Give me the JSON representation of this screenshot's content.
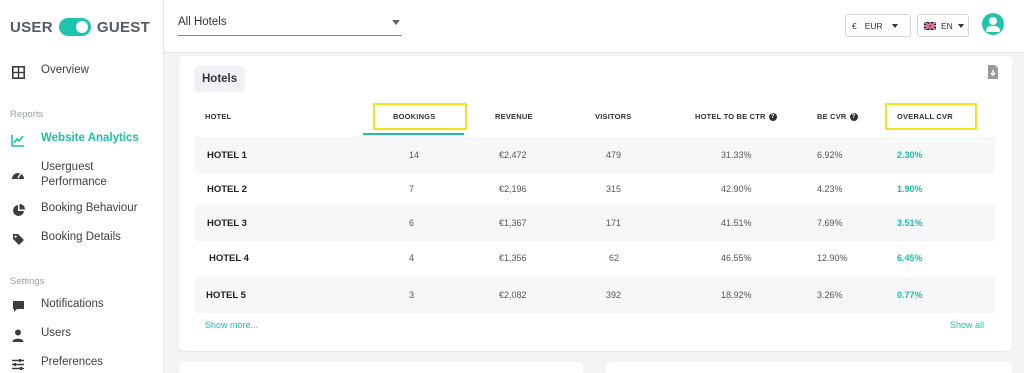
{
  "brand": {
    "left": "USER",
    "right": "GUEST"
  },
  "sidebar": {
    "items": [
      {
        "label": "Overview",
        "icon": "grid-icon"
      },
      {
        "label": "Website Analytics",
        "icon": "chart-line-icon",
        "active": true
      },
      {
        "label": "Userguest Performance",
        "line1": "Userguest",
        "line2": "Performance",
        "icon": "dashboard-gauge-icon"
      },
      {
        "label": "Booking Behaviour",
        "icon": "pie-chart-icon"
      },
      {
        "label": "Booking Details",
        "icon": "tag-icon"
      },
      {
        "label": "Notifications",
        "icon": "chat-bubble-icon"
      },
      {
        "label": "Users",
        "icon": "user-icon"
      },
      {
        "label": "Preferences",
        "icon": "sliders-icon"
      }
    ],
    "sections": {
      "reports": "Reports",
      "settings": "Settings"
    }
  },
  "topbar": {
    "hotel_select": "All Hotels",
    "currency": {
      "symbol": "€",
      "code": "EUR"
    },
    "language": "EN"
  },
  "card": {
    "tab": "Hotels",
    "columns": [
      "HOTEL",
      "BOOKINGS",
      "REVENUE",
      "VISITORS",
      "HOTEL TO BE CTR",
      "BE CVR",
      "OVERALL CVR"
    ],
    "rows": [
      {
        "hotel": "HOTEL 1",
        "bookings": "14",
        "revenue": "€2,472",
        "visitors": "479",
        "ctr": "31.33%",
        "be_cvr": "6.92%",
        "overall_cvr": "2.30%"
      },
      {
        "hotel": "HOTEL 2",
        "bookings": "7",
        "revenue": "€2,196",
        "visitors": "315",
        "ctr": "42.90%",
        "be_cvr": "4.23%",
        "overall_cvr": "1.90%"
      },
      {
        "hotel": "HOTEL 3",
        "bookings": "6",
        "revenue": "€1,367",
        "visitors": "171",
        "ctr": "41.51%",
        "be_cvr": "7.69%",
        "overall_cvr": "3.51%"
      },
      {
        "hotel": "HOTEL 4",
        "bookings": "4",
        "revenue": "€1,356",
        "visitors": "62",
        "ctr": "46.55%",
        "be_cvr": "12.90%",
        "overall_cvr": "6.45%"
      },
      {
        "hotel": "HOTEL 5",
        "bookings": "3",
        "revenue": "€2,082",
        "visitors": "392",
        "ctr": "18.92%",
        "be_cvr": "3.26%",
        "overall_cvr": "0.77%"
      }
    ],
    "show_more": "Show more...",
    "show_all": "Show all"
  },
  "colors": {
    "accent": "#1fbfa6",
    "highlight": "#f1e21b"
  }
}
